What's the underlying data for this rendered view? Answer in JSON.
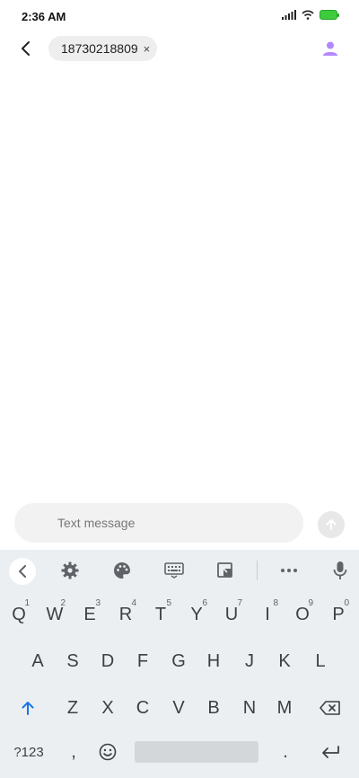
{
  "status_bar": {
    "time": "2:36 AM"
  },
  "header": {
    "recipient": "18730218809",
    "chip_remove": "×"
  },
  "compose": {
    "placeholder": "Text message"
  },
  "keyboard": {
    "row1": [
      {
        "letter": "Q",
        "hint": "1"
      },
      {
        "letter": "W",
        "hint": "2"
      },
      {
        "letter": "E",
        "hint": "3"
      },
      {
        "letter": "R",
        "hint": "4"
      },
      {
        "letter": "T",
        "hint": "5"
      },
      {
        "letter": "Y",
        "hint": "6"
      },
      {
        "letter": "U",
        "hint": "7"
      },
      {
        "letter": "I",
        "hint": "8"
      },
      {
        "letter": "O",
        "hint": "9"
      },
      {
        "letter": "P",
        "hint": "0"
      }
    ],
    "row2": [
      "A",
      "S",
      "D",
      "F",
      "G",
      "H",
      "J",
      "K",
      "L"
    ],
    "row3": [
      "Z",
      "X",
      "C",
      "V",
      "B",
      "N",
      "M"
    ],
    "symbols_label": "?123",
    "comma": ",",
    "period": "."
  },
  "colors": {
    "accent_shift": "#1a73e8",
    "contact_icon": "#b388ff"
  }
}
